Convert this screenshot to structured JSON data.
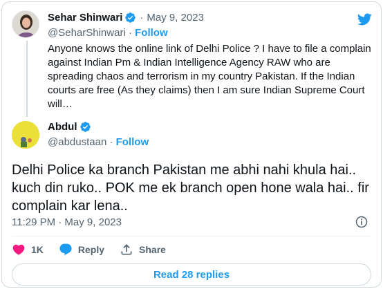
{
  "colors": {
    "accent": "#1d9bf0",
    "like": "#f91880",
    "muted": "#536471",
    "text": "#0f1419",
    "border": "#cfd9de"
  },
  "header_icon": "twitter-bird-icon",
  "parent_tweet": {
    "author_name": "Sehar Shinwari",
    "verified": true,
    "date": "May 9, 2023",
    "handle": "@SeharShinwari",
    "follow_label": "Follow",
    "text": "Anyone knows the online link of Delhi Police ? I have to file a complain against Indian Pm & Indian Intelligence Agency RAW who are spreading chaos and terrorism in my country Pakistan. If the Indian courts are free (As they claims) then I am sure Indian Supreme Court will…"
  },
  "reply_tweet": {
    "author_name": "Abdul",
    "verified": true,
    "handle": "@abdustaan",
    "follow_label": "Follow",
    "text": "Delhi Police ka branch Pakistan me abhi nahi khula hai.. kuch din ruko.. POK me ek branch open hone wala hai.. fir complain kar lena..",
    "timestamp": "11:29 PM · May 9, 2023",
    "info_icon": "info-icon"
  },
  "actions": {
    "like_count": "1K",
    "reply_label": "Reply",
    "share_label": "Share"
  },
  "read_replies_label": "Read 28 replies"
}
